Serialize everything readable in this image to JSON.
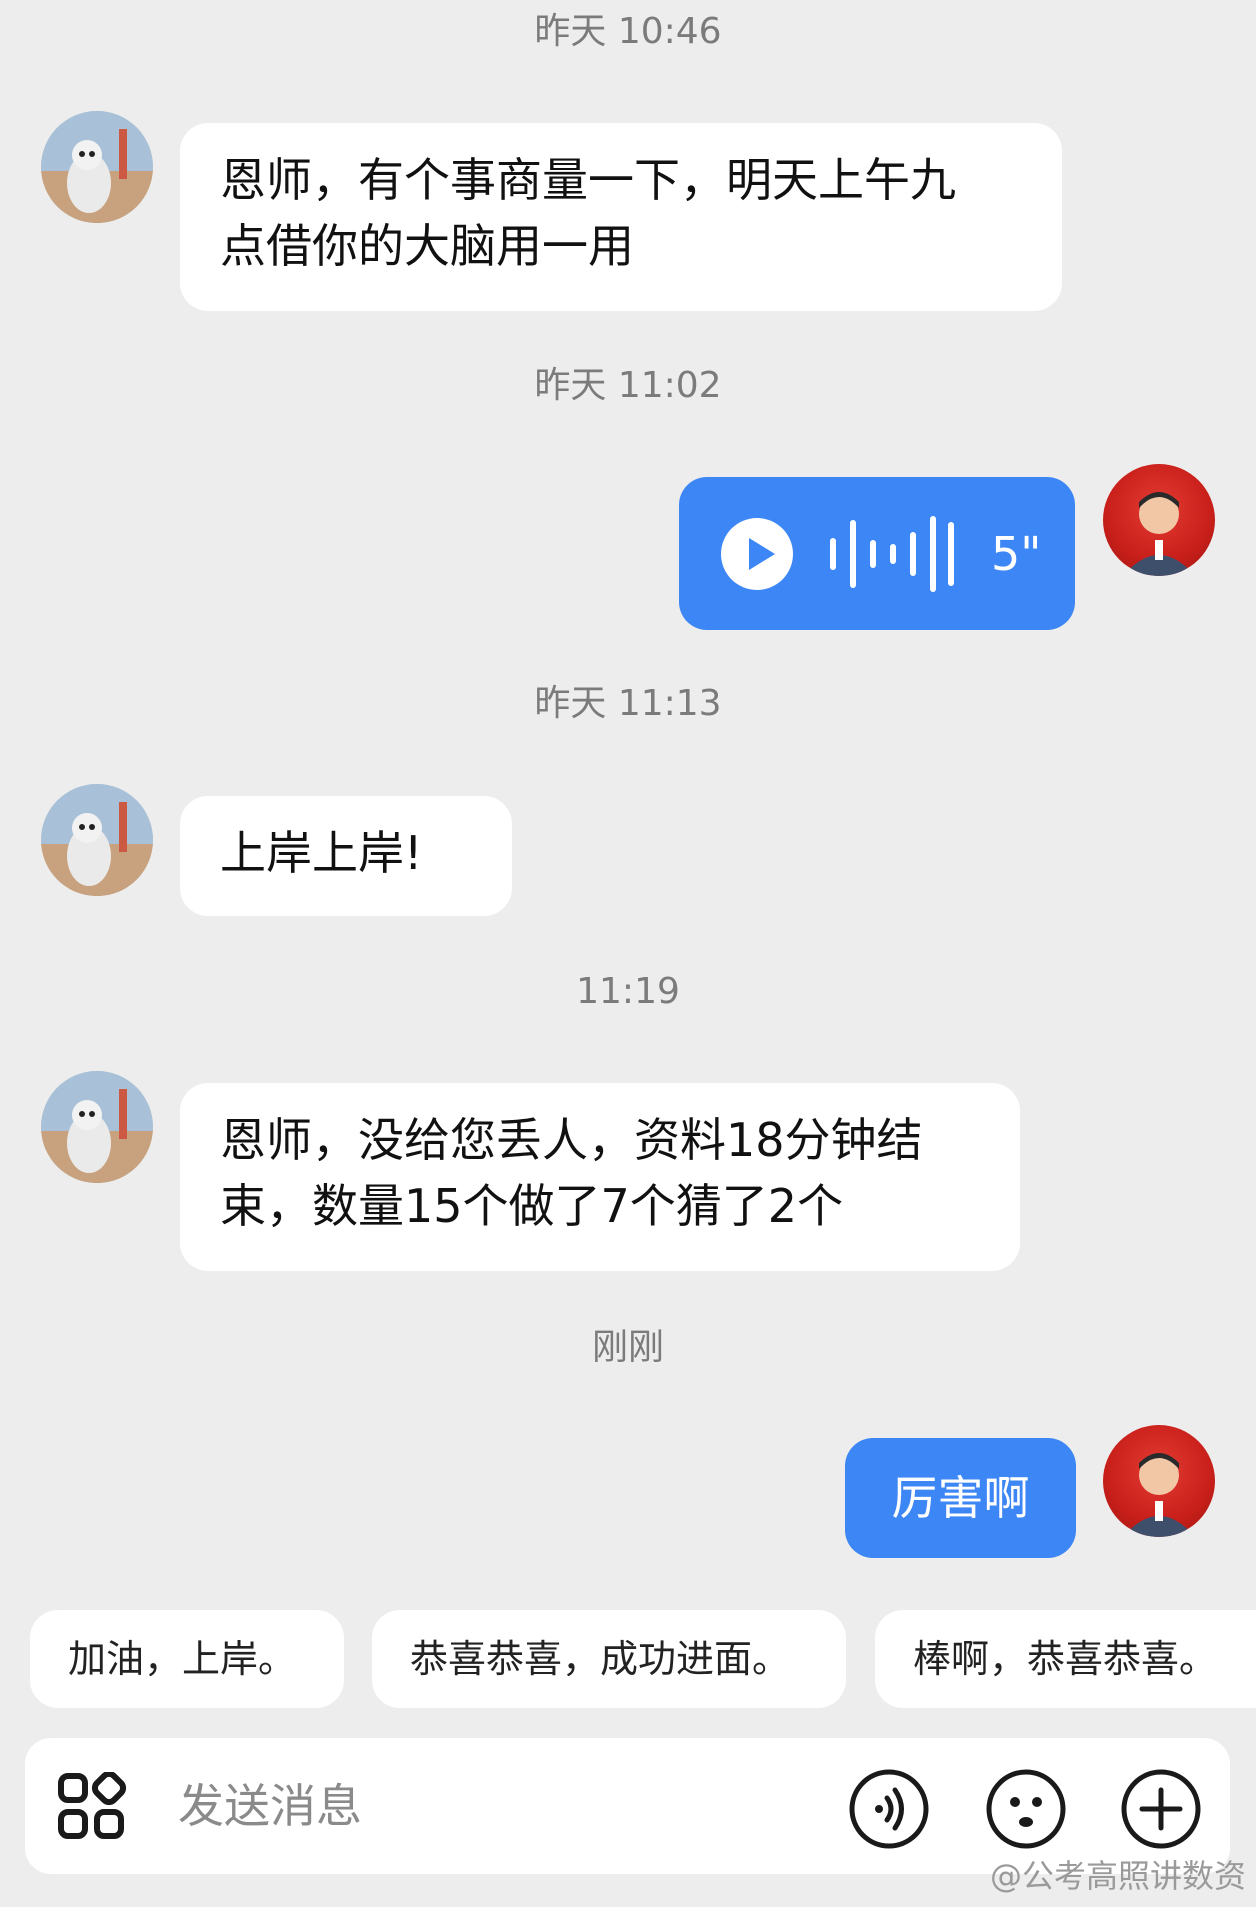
{
  "messages": {
    "m1": {
      "time": "昨天 10:46",
      "text": "恩师，有个事商量一下，明天上午九\n点借你的大脑用一用"
    },
    "m2": {
      "time": "昨天 11:02",
      "voice_duration": "5\""
    },
    "m3": {
      "time": "昨天 11:13",
      "text": "上岸上岸!"
    },
    "m4": {
      "time": "11:19",
      "text": "恩师，没给您丢人，资料18分钟结\n束，数量15个做了7个猜了2个"
    },
    "m5": {
      "time": "刚刚",
      "text": "厉害啊"
    }
  },
  "quick_replies": [
    "加油，上岸。",
    "恭喜恭喜，成功进面。",
    "棒啊，恭喜恭喜。"
  ],
  "input": {
    "placeholder": "发送消息"
  },
  "watermark": "@公考高照讲数资",
  "colors": {
    "accent": "#3d86f5",
    "background": "#ededed",
    "bubble_in": "#ffffff"
  },
  "icons": [
    "apps-icon",
    "voice-input-icon",
    "emoji-icon",
    "plus-icon",
    "play-icon",
    "waveform-icon"
  ]
}
